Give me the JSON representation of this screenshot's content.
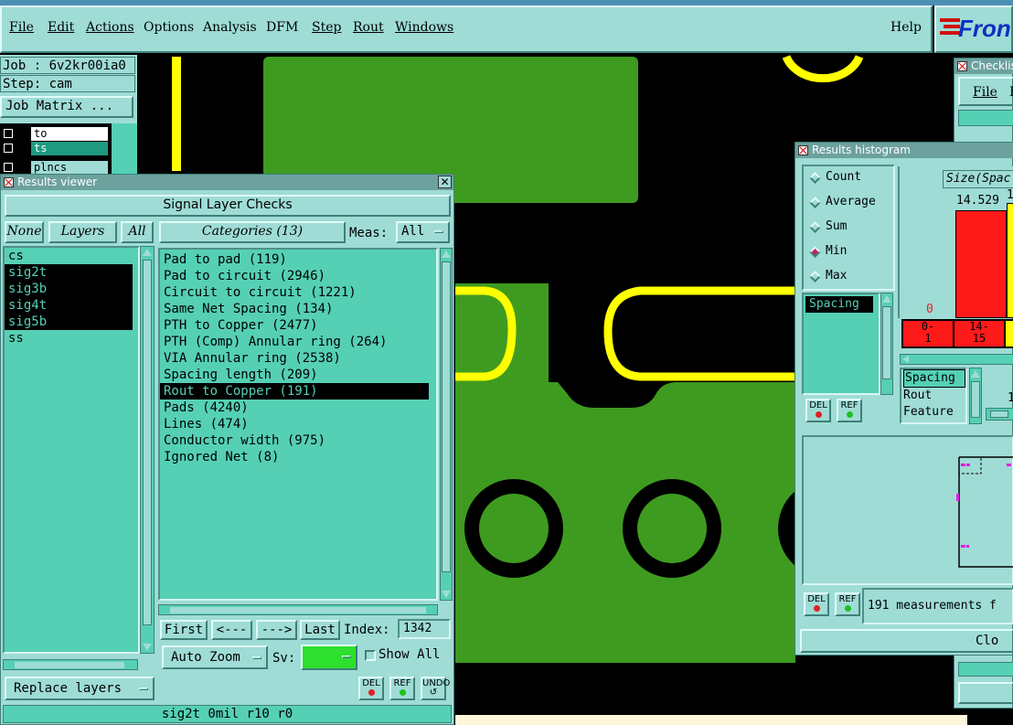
{
  "menubar": {
    "items": [
      "File",
      "Edit",
      "Actions",
      "Options",
      "Analysis",
      "DFM",
      "Step",
      "Rout",
      "Windows"
    ],
    "help": "Help",
    "brand": "Fron"
  },
  "job_panel": {
    "job": "Job : 6v2kr00ia0",
    "step": "Step: cam",
    "matrix_button": "Job Matrix ...",
    "layers": [
      "to",
      "ts",
      "plncs"
    ]
  },
  "results_viewer": {
    "title": "Results viewer",
    "header": "Signal Layer Checks",
    "none_btn": "None",
    "layers_btn": "Layers",
    "all_btn": "All",
    "categories_btn": "Categories (13)",
    "meas_label": "Meas:",
    "meas_value": "All",
    "layers": [
      {
        "name": "cs",
        "selected": false
      },
      {
        "name": "sig2t",
        "selected": true
      },
      {
        "name": "sig3b",
        "selected": true
      },
      {
        "name": "sig4t",
        "selected": true
      },
      {
        "name": "sig5b",
        "selected": true
      },
      {
        "name": "ss",
        "selected": false
      }
    ],
    "categories": [
      {
        "name": "Pad to pad (119)",
        "selected": false
      },
      {
        "name": "Pad to circuit (2946)",
        "selected": false
      },
      {
        "name": "Circuit to circuit (1221)",
        "selected": false
      },
      {
        "name": "Same Net Spacing (134)",
        "selected": false
      },
      {
        "name": "PTH to Copper (2477)",
        "selected": false
      },
      {
        "name": "PTH (Comp) Annular ring (264)",
        "selected": false
      },
      {
        "name": "VIA Annular ring (2538)",
        "selected": false
      },
      {
        "name": "Spacing length (209)",
        "selected": false
      },
      {
        "name": "Rout to Copper (191)",
        "selected": true
      },
      {
        "name": "Pads (4240)",
        "selected": false
      },
      {
        "name": "Lines (474)",
        "selected": false
      },
      {
        "name": "Conductor width (975)",
        "selected": false
      },
      {
        "name": "Ignored Net (8)",
        "selected": false
      }
    ],
    "nav": {
      "first": "First",
      "prev": "<---",
      "next": "--->",
      "last": "Last",
      "index_label": "Index:",
      "index_value": "1342"
    },
    "auto_zoom": "Auto Zoom",
    "sv_label": "Sv:",
    "show_all": "Show All",
    "replace_layers": "Replace layers",
    "status": "sig2t 0mil  r10  r0",
    "del": "DEL",
    "ref": "REF",
    "undo": "UNDO"
  },
  "checklist": {
    "title": "Checklis",
    "file": "File",
    "partial": "F"
  },
  "histogram": {
    "title": "Results histogram",
    "modes": [
      {
        "label": "Count",
        "on": false
      },
      {
        "label": "Average",
        "on": false
      },
      {
        "label": "Sum",
        "on": false
      },
      {
        "label": "Min",
        "on": true
      },
      {
        "label": "Max",
        "on": false
      }
    ],
    "measure_item": "Spacing",
    "chart_title": "Size(Spac",
    "bar_value": "14.529",
    "bar_value2": "1",
    "zero_label": "0",
    "bins": [
      "0-\n1",
      "14-\n15"
    ],
    "bin1": "0-",
    "bin1b": "1",
    "bin2": "14-",
    "bin2b": "15",
    "feature_list": [
      "Spacing",
      "Rout",
      "Feature"
    ],
    "partial_num": "1",
    "status": "191 measurements f",
    "close": "Clo",
    "del": "DEL",
    "ref": "REF"
  },
  "colors": {
    "teal": "#9fdcd6",
    "list": "#55d0b4",
    "board": "#3e9b1f",
    "trace": "#ffff00",
    "bar_red": "#ff1a1a"
  }
}
